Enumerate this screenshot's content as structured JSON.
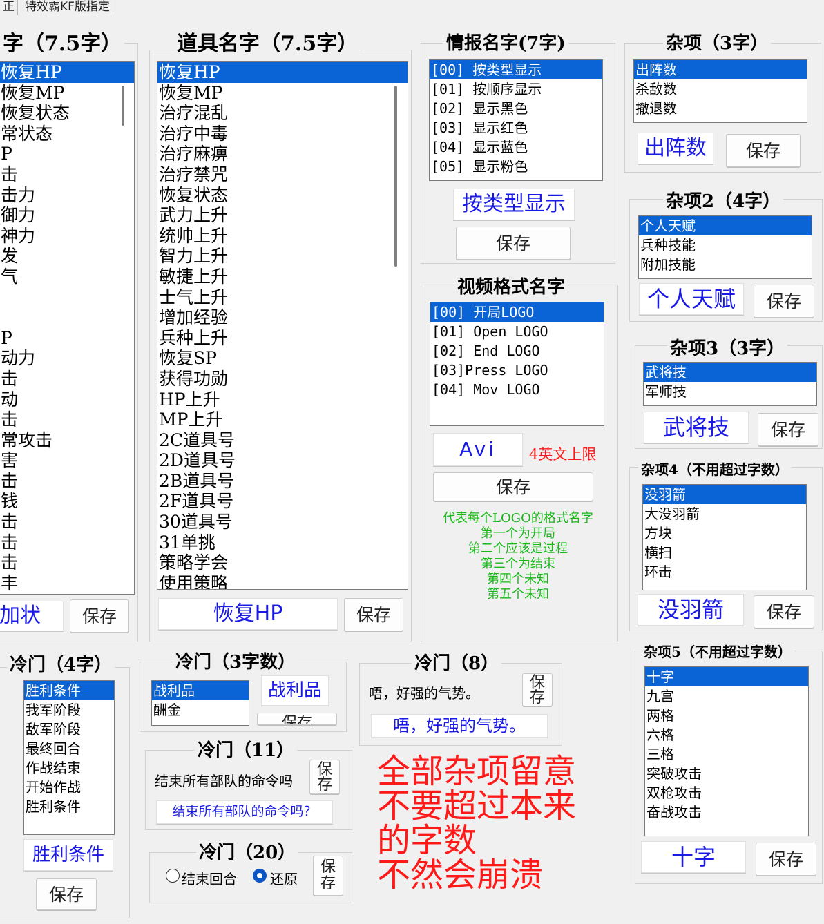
{
  "tabs": [
    "正",
    "特效霸KF版指定"
  ],
  "left": {
    "title": "字（7.5字）",
    "items": [
      "恢复HP",
      "恢复MP",
      "恢复状态",
      "常状态",
      "P",
      "击",
      "击力",
      "御力",
      "神力",
      "发",
      "气",
      "",
      "",
      "P",
      "动力",
      "击",
      "动",
      "击",
      "常攻击",
      "害",
      "击",
      "钱",
      "击",
      "击",
      "击",
      "丰"
    ],
    "display": "加状",
    "save": "保存"
  },
  "item_names": {
    "title": "道具名字（7.5字）",
    "items": [
      "恢复HP",
      "恢复MP",
      "治疗混乱",
      "治疗中毒",
      "治疗麻痹",
      "治疗禁咒",
      "恢复状态",
      "武力上升",
      "统帅上升",
      "智力上升",
      "敏捷上升",
      "士气上升",
      "增加经验",
      "兵种上升",
      "恢复SP",
      "获得功勋",
      "HP上升",
      "MP上升",
      "2C道具号",
      "2D道具号",
      "2B道具号",
      "2F道具号",
      "30道具号",
      "31单挑",
      "策略学会",
      "使用策略"
    ],
    "display": "恢复HP",
    "save": "保存"
  },
  "intel": {
    "title": "情报名字(7字)",
    "items": [
      "[00] 按类型显示",
      "[01] 按顺序显示",
      "[02] 显示黑色",
      "[03] 显示红色",
      "[04] 显示蓝色",
      "[05] 显示粉色"
    ],
    "display": "按类型显示",
    "save": "保存"
  },
  "video": {
    "title": "视频格式名字",
    "items": [
      "[00] 开局LOGO",
      "[01] Open LOGO",
      "[02] End LOGO",
      "[03]Press LOGO",
      "[04] Mov LOGO"
    ],
    "display": "Avi",
    "limit_note": "4英文上限",
    "save": "保存",
    "notes": [
      "代表每个LOGO的格式名字",
      "第一个为开局",
      "第二个应该是过程",
      "第三个为结束",
      "第四个未知",
      "第五个未知"
    ]
  },
  "misc1": {
    "title": "杂项（3字）",
    "items": [
      "出阵数",
      "杀敌数",
      "撤退数"
    ],
    "display": "出阵数",
    "save": "保存"
  },
  "misc2": {
    "title": "杂项2（4字）",
    "items": [
      "个人天赋",
      "兵种技能",
      "附加技能"
    ],
    "display": "个人天赋",
    "save": "保存"
  },
  "misc3": {
    "title": "杂项3（3字）",
    "items": [
      "武将技",
      "军师技"
    ],
    "display": "武将技",
    "save": "保存"
  },
  "misc4": {
    "title": "杂项4（不用超过字数）",
    "items": [
      "没羽箭",
      "大没羽箭",
      "方块",
      "横扫",
      "环击"
    ],
    "display": "没羽箭",
    "save": "保存"
  },
  "misc5": {
    "title": "杂项5（不用超过字数）",
    "items": [
      "十字",
      "九宫",
      "两格",
      "六格",
      "三格",
      "突破攻击",
      "双枪攻击",
      "奋战攻击"
    ],
    "display": "十字",
    "save": "保存"
  },
  "cold4": {
    "title": "冷门（4字）",
    "items": [
      "胜利条件",
      "我军阶段",
      "敌军阶段",
      "最终回合",
      "作战结束",
      "开始作战",
      "胜利条件"
    ],
    "display": "胜利条件",
    "save": "保存"
  },
  "cold3": {
    "title": "冷门（3字数）",
    "items": [
      "战利品",
      "酬金"
    ],
    "display": "战利品",
    "save": "保存"
  },
  "cold8": {
    "title": "冷门（8）",
    "label": "唔，好强的气势。",
    "display": "唔，好强的气势。",
    "save": "保存"
  },
  "cold11": {
    "title": "冷门（11）",
    "label": "结束所有部队的命令吗",
    "display": "结束所有部队的命令吗？",
    "save": "保存"
  },
  "cold20": {
    "title": "冷门（20）",
    "radio1": "结束回合",
    "radio2": "还原",
    "save": "保存"
  },
  "warning": [
    "全部杂项留意",
    "不要超过本来",
    "的字数",
    "不然会崩溃"
  ],
  "colors": {
    "selection": "#0a64d6",
    "display_text": "#1a1ae6",
    "warning": "#ff1a1a",
    "notes": "#18b818"
  }
}
